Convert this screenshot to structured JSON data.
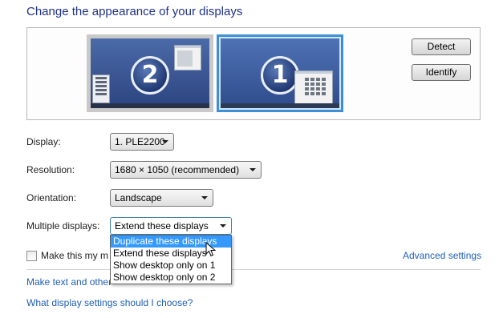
{
  "page": {
    "title": "Change the appearance of your displays"
  },
  "preview": {
    "monitors": [
      {
        "number": "2",
        "selected": false
      },
      {
        "number": "1",
        "selected": true
      }
    ],
    "detect_label": "Detect",
    "identify_label": "Identify"
  },
  "form": {
    "display": {
      "label": "Display:",
      "value": "1. PLE2200"
    },
    "resolution": {
      "label": "Resolution:",
      "value": "1680 × 1050 (recommended)"
    },
    "orientation": {
      "label": "Orientation:",
      "value": "Landscape"
    },
    "multiple_displays": {
      "label": "Multiple displays:",
      "value": "Extend these displays",
      "options": [
        "Duplicate these displays",
        "Extend these displays",
        "Show desktop only on 1",
        "Show desktop only on 2"
      ],
      "highlighted_option": "Duplicate these displays"
    },
    "main_display_checkbox": {
      "label": "Make this my ma",
      "checked": false
    }
  },
  "links": {
    "advanced_settings": "Advanced settings",
    "text_size": "Make text and other",
    "help": "What display settings should I choose?"
  },
  "colors": {
    "heading": "#1e3287",
    "link": "#1e5fb4",
    "selection": "#3399ff",
    "selected_monitor_border": "#3d8fd6"
  }
}
